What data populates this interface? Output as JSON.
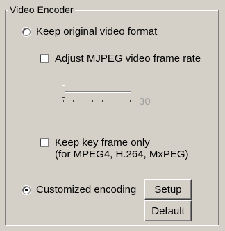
{
  "group": {
    "title": "Video Encoder"
  },
  "options": {
    "keep_original_label": "Keep original video format",
    "adjust_mjpeg_label": "Adjust MJPEG video frame rate",
    "frame_rate_value": "30",
    "keep_key_frame_line1": "Keep key frame only",
    "keep_key_frame_line2": "(for MPEG4, H.264, MxPEG)",
    "customized_label": "Customized encoding"
  },
  "buttons": {
    "setup_label": "Setup",
    "default_label": "Default"
  },
  "state": {
    "keep_original_selected": false,
    "customized_selected": true,
    "adjust_mjpeg_checked": false,
    "keep_key_frame_checked": false,
    "frame_rate_slider_level": 0
  }
}
